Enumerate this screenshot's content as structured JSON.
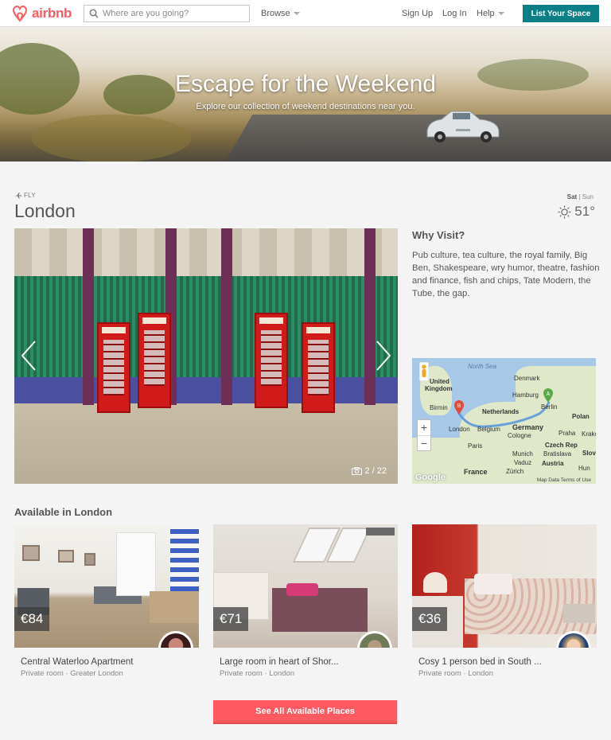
{
  "header": {
    "brand": "airbnb",
    "search_placeholder": "Where are you going?",
    "browse": "Browse",
    "sign_up": "Sign Up",
    "log_in": "Log In",
    "help": "Help",
    "list_space": "List Your Space"
  },
  "hero": {
    "title": "Escape for the Weekend",
    "subtitle": "Explore our collection of weekend destinations near you."
  },
  "destination": {
    "travel_mode": "FLY",
    "city": "London",
    "weather": {
      "day_active": "Sat",
      "separator": "|",
      "day_other": "Sun",
      "temperature": "51°",
      "icon": "sun-icon"
    },
    "photo_counter": "2 / 22",
    "why_title": "Why Visit?",
    "why_text": "Pub culture, tea culture, the royal family, Big Ben, Shakespeare, wry humor, theatre, fashion and finance, fish and chips, Tate Modern, the Tube, the gap."
  },
  "map": {
    "labels": {
      "north_sea": "North Sea",
      "denmark": "Denmark",
      "uk": "United",
      "uk2": "Kingdom",
      "hamburg": "Hamburg",
      "berlin": "Berlin",
      "birmingham": "Birmin",
      "netherlands": "Netherlands",
      "poland": "Polan",
      "london": "London",
      "belgium": "Belgium",
      "germany": "Germany",
      "cologne": "Cologne",
      "praha": "Praha",
      "krakow": "Krako",
      "paris": "Paris",
      "czech": "Czech Rep",
      "munich": "Munich",
      "bratislava": "Bratislava",
      "slovakia": "Slov",
      "vaduz": "Vaduz",
      "austria": "Austria",
      "france": "France",
      "zurich": "Zürich",
      "hungary": "Hun"
    },
    "marker_a": "A",
    "marker_b": "B",
    "zoom_in": "+",
    "zoom_out": "−",
    "google": "Google",
    "footer": "Map Data    Terms of Use"
  },
  "listings": {
    "section_title": "Available in London",
    "items": [
      {
        "price": "€84",
        "title": "Central Waterloo Apartment",
        "subtitle": "Private room · Greater London"
      },
      {
        "price": "€71",
        "title": "Large room in heart of Shor...",
        "subtitle": "Private room · London"
      },
      {
        "price": "€36",
        "title": "Cosy 1 person bed in South ...",
        "subtitle": "Private room · London"
      }
    ],
    "see_all": "See All Available Places"
  },
  "colors": {
    "brand": "#ff5a5f",
    "teal": "#0c7e86"
  }
}
